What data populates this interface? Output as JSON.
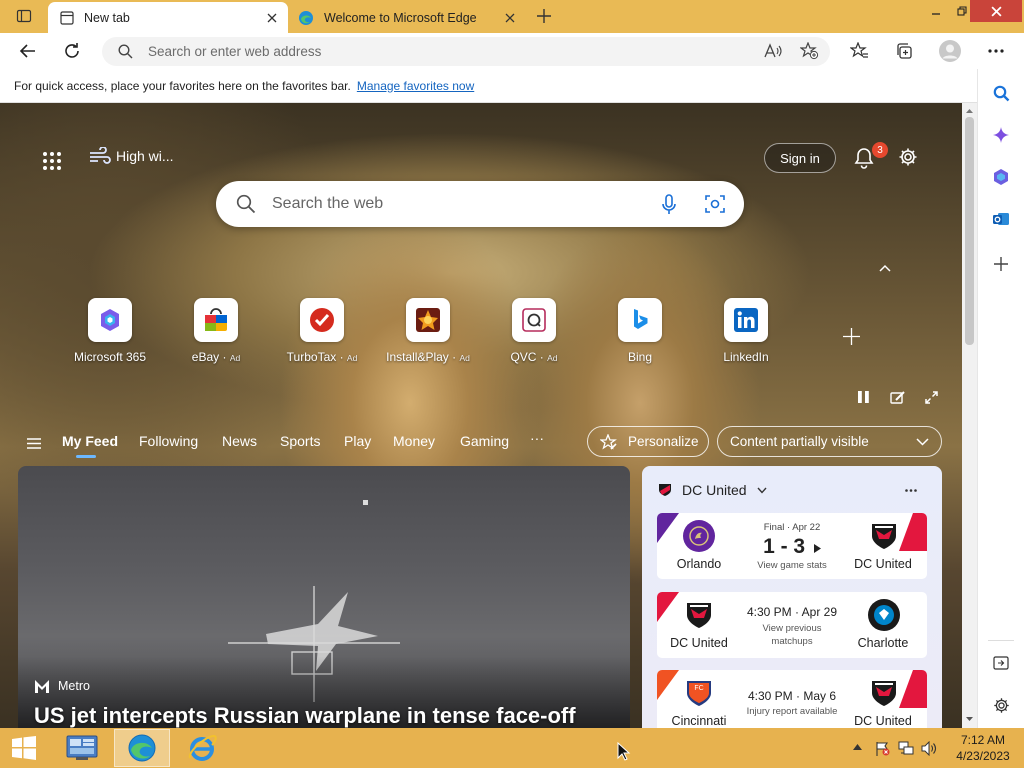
{
  "browser": {
    "tabs": [
      {
        "title": "New tab",
        "icon": "newtab-icon",
        "active": true
      },
      {
        "title": "Welcome to Microsoft Edge",
        "icon": "edge-icon",
        "active": false
      }
    ],
    "address_placeholder": "Search or enter web address",
    "favorites_bar_message": "For quick access, place your favorites here on the favorites bar.",
    "favorites_bar_link": "Manage favorites now"
  },
  "newtab": {
    "weather_text": "High wi...",
    "signin_label": "Sign in",
    "notification_count": "3",
    "search_placeholder": "Search the web",
    "quick_links": [
      {
        "label": "Microsoft 365",
        "ad": "",
        "icon": "microsoft-365-icon"
      },
      {
        "label": "eBay",
        "ad": "Ad",
        "icon": "ebay-icon"
      },
      {
        "label": "TurboTax",
        "ad": "Ad",
        "icon": "turbotax-icon"
      },
      {
        "label": "Install&Play",
        "ad": "Ad",
        "icon": "install-play-icon"
      },
      {
        "label": "QVC",
        "ad": "Ad",
        "icon": "qvc-icon"
      },
      {
        "label": "Bing",
        "ad": "",
        "icon": "bing-icon"
      },
      {
        "label": "LinkedIn",
        "ad": "",
        "icon": "linkedin-icon"
      }
    ],
    "feed_nav": [
      "My Feed",
      "Following",
      "News",
      "Sports",
      "Play",
      "Money",
      "Gaming"
    ],
    "more_label": "···",
    "personalize_label": "Personalize",
    "content_visibility_label": "Content partially visible"
  },
  "news": {
    "source": "Metro",
    "headline": "US jet intercepts Russian warplane in tense face-off"
  },
  "sports": {
    "team": "DC United",
    "matches": [
      {
        "home": "Orlando",
        "away": "DC United",
        "status": "Final · Apr 22",
        "score": "1 - 3",
        "sub": "View game stats"
      },
      {
        "home": "DC United",
        "away": "Charlotte",
        "status": "4:30 PM · Apr 29",
        "sub": "View previous matchups"
      },
      {
        "home": "Cincinnati",
        "away": "DC United",
        "status": "4:30 PM · May 6",
        "sub": "Injury report available"
      }
    ]
  },
  "taskbar": {
    "time": "7:12 AM",
    "date": "4/23/2023"
  },
  "colors": {
    "titlebar": "#e9ba55",
    "taskbar": "#e7b24f",
    "link": "#1565c0",
    "badge": "#e5482e",
    "orlando": "#61259e",
    "dc_united": "#e3173e",
    "cincinnati": "#f05323"
  }
}
